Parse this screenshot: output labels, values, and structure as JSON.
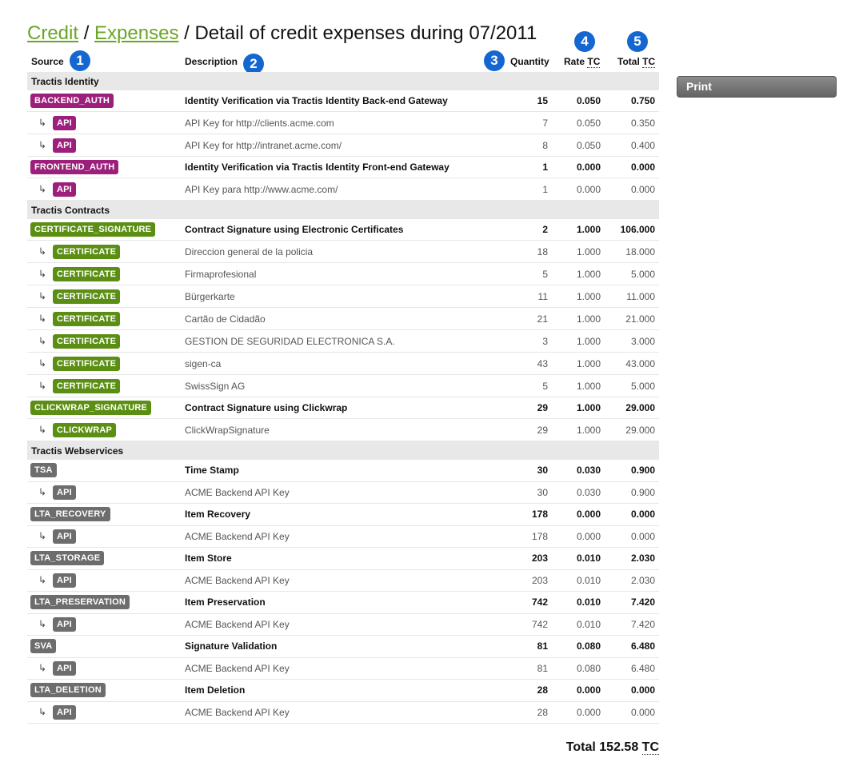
{
  "breadcrumb": {
    "credit": "Credit",
    "sep1": " / ",
    "expenses": "Expenses",
    "sep2": " / ",
    "title": "Detail of credit expenses during 07/2011"
  },
  "headers": {
    "source": "Source",
    "description": "Description",
    "quantity": "Quantity",
    "rate": "Rate",
    "rate_unit": "TC",
    "total": "Total",
    "total_unit": "TC"
  },
  "markers": [
    "1",
    "2",
    "3",
    "4",
    "5"
  ],
  "colors": {
    "identity": "#9c1f7b",
    "contracts": "#5b8f13",
    "webservices": "#6d6d6d",
    "link": "#6aa526",
    "marker": "#1466d1"
  },
  "arrow_glyph": "↳",
  "groups": [
    {
      "name": "Tractis Identity",
      "color": "#9c1f7b",
      "items": [
        {
          "tag": "BACKEND_AUTH",
          "description": "Identity Verification via Tractis Identity Back-end Gateway",
          "qty": "15",
          "rate": "0.050",
          "total": "0.750",
          "subs": [
            {
              "tag": "API",
              "description": "API Key for http://clients.acme.com",
              "qty": "7",
              "rate": "0.050",
              "total": "0.350"
            },
            {
              "tag": "API",
              "description": "API Key for http://intranet.acme.com/",
              "qty": "8",
              "rate": "0.050",
              "total": "0.400"
            }
          ]
        },
        {
          "tag": "FRONTEND_AUTH",
          "description": "Identity Verification via Tractis Identity Front-end Gateway",
          "qty": "1",
          "rate": "0.000",
          "total": "0.000",
          "subs": [
            {
              "tag": "API",
              "description": "API Key para http://www.acme.com/",
              "qty": "1",
              "rate": "0.000",
              "total": "0.000"
            }
          ]
        }
      ]
    },
    {
      "name": "Tractis Contracts",
      "color": "#5b8f13",
      "items": [
        {
          "tag": "CERTIFICATE_SIGNATURE",
          "description": "Contract Signature using Electronic Certificates",
          "qty": "2",
          "rate": "1.000",
          "total": "106.000",
          "subs": [
            {
              "tag": "CERTIFICATE",
              "description": "Direccion general de la policia",
              "qty": "18",
              "rate": "1.000",
              "total": "18.000"
            },
            {
              "tag": "CERTIFICATE",
              "description": "Firmaprofesional",
              "qty": "5",
              "rate": "1.000",
              "total": "5.000"
            },
            {
              "tag": "CERTIFICATE",
              "description": "Bürgerkarte",
              "qty": "11",
              "rate": "1.000",
              "total": "11.000"
            },
            {
              "tag": "CERTIFICATE",
              "description": "Cartão de Cidadão",
              "qty": "21",
              "rate": "1.000",
              "total": "21.000"
            },
            {
              "tag": "CERTIFICATE",
              "description": "GESTION DE SEGURIDAD ELECTRONICA S.A.",
              "qty": "3",
              "rate": "1.000",
              "total": "3.000"
            },
            {
              "tag": "CERTIFICATE",
              "description": "sigen-ca",
              "qty": "43",
              "rate": "1.000",
              "total": "43.000"
            },
            {
              "tag": "CERTIFICATE",
              "description": "SwissSign AG",
              "qty": "5",
              "rate": "1.000",
              "total": "5.000"
            }
          ]
        },
        {
          "tag": "CLICKWRAP_SIGNATURE",
          "description": "Contract Signature using Clickwrap",
          "qty": "29",
          "rate": "1.000",
          "total": "29.000",
          "subs": [
            {
              "tag": "CLICKWRAP",
              "description": "ClickWrapSignature",
              "qty": "29",
              "rate": "1.000",
              "total": "29.000"
            }
          ]
        }
      ]
    },
    {
      "name": "Tractis Webservices",
      "color": "#6d6d6d",
      "items": [
        {
          "tag": "TSA",
          "description": "Time Stamp",
          "qty": "30",
          "rate": "0.030",
          "total": "0.900",
          "subs": [
            {
              "tag": "API",
              "description": "ACME Backend API Key",
              "qty": "30",
              "rate": "0.030",
              "total": "0.900"
            }
          ]
        },
        {
          "tag": "LTA_RECOVERY",
          "description": "Item Recovery",
          "qty": "178",
          "rate": "0.000",
          "total": "0.000",
          "subs": [
            {
              "tag": "API",
              "description": "ACME Backend API Key",
              "qty": "178",
              "rate": "0.000",
              "total": "0.000"
            }
          ]
        },
        {
          "tag": "LTA_STORAGE",
          "description": "Item Store",
          "qty": "203",
          "rate": "0.010",
          "total": "2.030",
          "subs": [
            {
              "tag": "API",
              "description": "ACME Backend API Key",
              "qty": "203",
              "rate": "0.010",
              "total": "2.030"
            }
          ]
        },
        {
          "tag": "LTA_PRESERVATION",
          "description": "Item Preservation",
          "qty": "742",
          "rate": "0.010",
          "total": "7.420",
          "subs": [
            {
              "tag": "API",
              "description": "ACME Backend API Key",
              "qty": "742",
              "rate": "0.010",
              "total": "7.420"
            }
          ]
        },
        {
          "tag": "SVA",
          "description": "Signature Validation",
          "qty": "81",
          "rate": "0.080",
          "total": "6.480",
          "subs": [
            {
              "tag": "API",
              "description": "ACME Backend API Key",
              "qty": "81",
              "rate": "0.080",
              "total": "6.480"
            }
          ]
        },
        {
          "tag": "LTA_DELETION",
          "description": "Item Deletion",
          "qty": "28",
          "rate": "0.000",
          "total": "0.000",
          "subs": [
            {
              "tag": "API",
              "description": "ACME Backend API Key",
              "qty": "28",
              "rate": "0.000",
              "total": "0.000"
            }
          ]
        }
      ]
    }
  ],
  "total": {
    "label": "Total",
    "value": "152.58",
    "unit": "TC"
  },
  "print_label": "Print"
}
